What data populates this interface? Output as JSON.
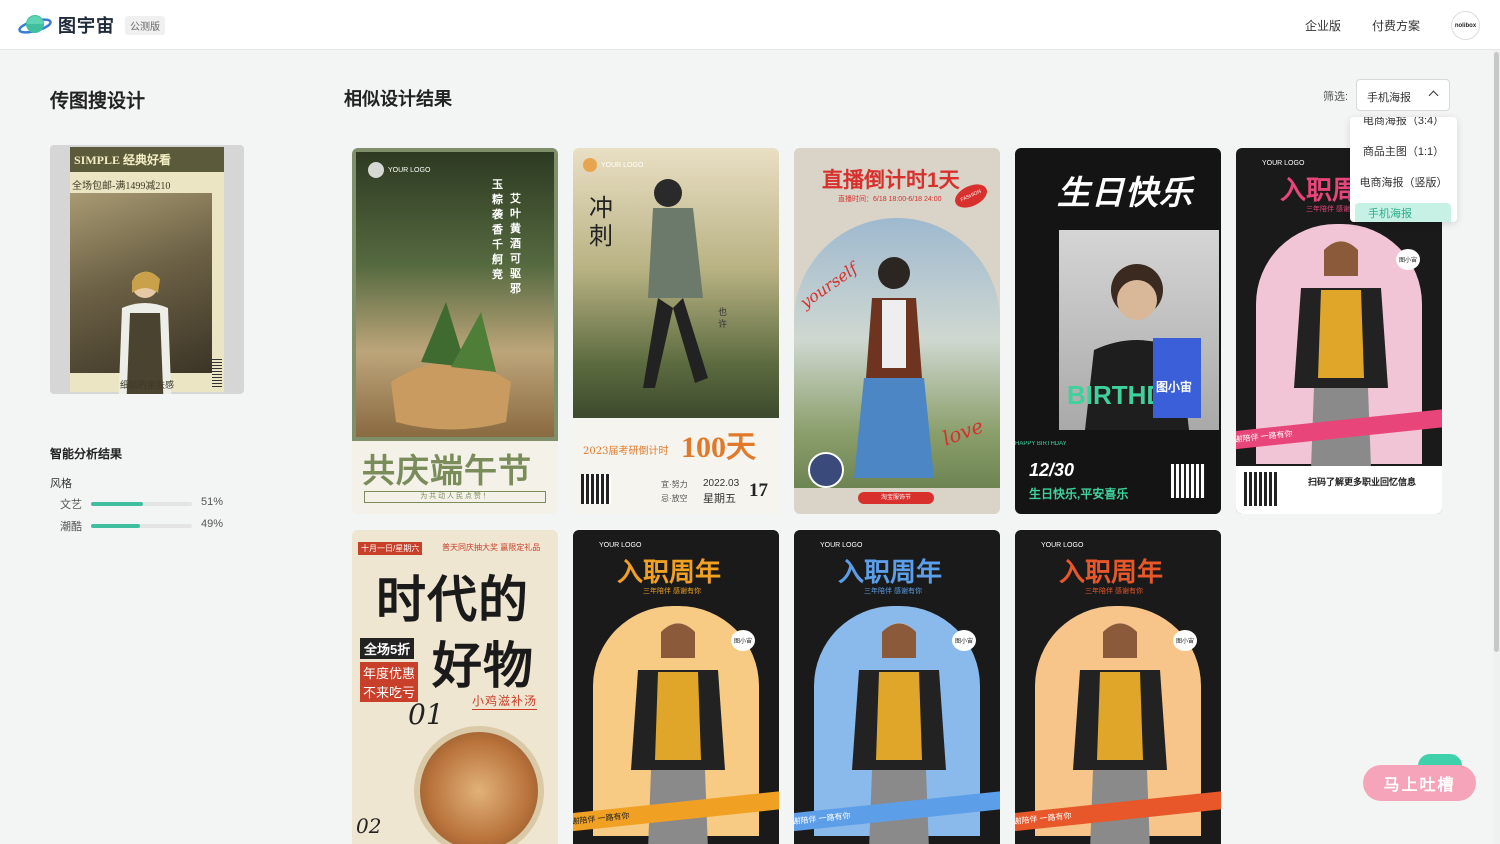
{
  "header": {
    "brand": "图宇宙",
    "badge": "公测版",
    "nav": [
      "企业版",
      "付费方案"
    ],
    "avatar_text": "nolibox"
  },
  "left": {
    "title": "传图搜设计",
    "upload": {
      "headline": "SIMPLE 经典好看",
      "subline": "全场包邮-满1499减210",
      "footer": "细腻的亲肤感"
    },
    "analysis_title": "智能分析结果",
    "style_label": "风格",
    "styles": [
      {
        "name": "文艺",
        "percent": "51%",
        "value": 51
      },
      {
        "name": "潮酷",
        "percent": "49%",
        "value": 49
      }
    ]
  },
  "main": {
    "title": "相似设计结果",
    "filter_label": "筛选:",
    "filter_value": "手机海报",
    "dropdown": [
      "电商海报（3:4）",
      "商品主图（1:1）",
      "电商海报（竖版）",
      "手机海报"
    ]
  },
  "cards": [
    {
      "title": "共庆端午节",
      "sub": "为 共 动 人 民 点 赞 ！",
      "logo": "YOUR LOGO",
      "verse_a": "玉粽袭香千舸竞",
      "verse_b": "艾叶黄酒可驱邪"
    },
    {
      "title_a": "冲",
      "title_b": "刺",
      "big": "100天",
      "caption": "2023届考研倒计时",
      "date": "2022.03",
      "day": "17",
      "weekday": "星期五",
      "logo": "YOUR LOGO",
      "side": "也许",
      "good": "宜·努力",
      "bad": "忌·放空"
    },
    {
      "title": "直播倒计时1天",
      "time": "直播时间：6/18 18:00-6/18 24:00",
      "script": "yourself",
      "love": "love",
      "badge": "FASHION",
      "bottom": "淘宝服饰节"
    },
    {
      "title": "生日快乐",
      "date": "12/30",
      "wish": "生日快乐,平安喜乐",
      "birth": "BIRTHDAY",
      "tag": "HAPPY BIRTHDAY",
      "brand": "图小宙"
    },
    {
      "title": "入职周年",
      "sub": "三年陪伴 感谢有你",
      "scan": "扫码了解更多职业回忆信息",
      "ribbon": "感谢陪伴 一路有你",
      "logo": "YOUR LOGO",
      "brand": "图小宙"
    },
    {
      "title_a": "时代的",
      "title_b": "好物",
      "tag1": "十月一日/星期六",
      "tag2": "普天同庆抽大奖 赢限定礼品",
      "sale": "全场5折",
      "promo_a": "年度优惠",
      "promo_b": "不来吃亏",
      "dish": "小鸡滋补汤",
      "num": "01",
      "num2": "02"
    },
    {
      "title": "入职周年",
      "sub": "三年陪伴 感谢有你",
      "ribbon": "感谢陪伴 一路有你",
      "logo": "YOUR LOGO",
      "brand": "图小宙"
    },
    {
      "title": "入职周年",
      "sub": "三年陪伴 感谢有你",
      "ribbon": "感谢陪伴 一路有你",
      "logo": "YOUR LOGO",
      "brand": "图小宙"
    },
    {
      "title": "入职周年",
      "sub": "三年陪伴 感谢有你",
      "ribbon": "感谢陪伴 一路有你",
      "logo": "YOUR LOGO",
      "brand": "图小宙"
    }
  ],
  "feedback": "马上吐槽",
  "colors": {
    "accent": "#3fbf9f",
    "feedback": "#f6a4b9"
  }
}
